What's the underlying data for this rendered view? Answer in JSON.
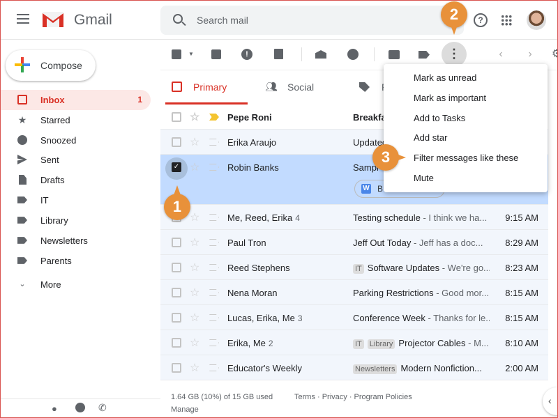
{
  "header": {
    "brand": "Gmail",
    "search_placeholder": "Search mail",
    "help": "?"
  },
  "compose": "Compose",
  "sidebar": {
    "items": [
      {
        "label": "Inbox",
        "count": "1",
        "icon": "inbox-icon"
      },
      {
        "label": "Starred",
        "icon": "star-icon"
      },
      {
        "label": "Snoozed",
        "icon": "clock-icon"
      },
      {
        "label": "Sent",
        "icon": "send-icon"
      },
      {
        "label": "Drafts",
        "icon": "draft-icon"
      },
      {
        "label": "IT",
        "icon": "label-icon"
      },
      {
        "label": "Library",
        "icon": "label-icon"
      },
      {
        "label": "Newsletters",
        "icon": "label-icon"
      },
      {
        "label": "Parents",
        "icon": "label-icon"
      },
      {
        "label": "More",
        "icon": "chevron-down-icon"
      }
    ]
  },
  "tabs": [
    {
      "label": "Primary"
    },
    {
      "label": "Social"
    },
    {
      "label": "P"
    }
  ],
  "emails": [
    {
      "from": "Pepe Roni",
      "subject": "Breakfa",
      "snippet": "",
      "time": "",
      "unread": true
    },
    {
      "from": "Erika Araujo",
      "subject": "Updated",
      "snippet": "",
      "time": ""
    },
    {
      "from": "Robin Banks",
      "subject": "Sampl",
      "snippet": "",
      "time": "",
      "selected": true,
      "attachment": "B"
    },
    {
      "from": "Me, Reed, Erika",
      "count": "4",
      "subject": "Testing schedule",
      "snippet": " - I think we ha...",
      "time": "9:15 AM"
    },
    {
      "from": "Paul Tron",
      "subject": "Jeff Out Today ",
      "snippet": " - Jeff has a doc...",
      "time": "8:29 AM"
    },
    {
      "from": "Reed Stephens",
      "tags": [
        "IT"
      ],
      "subject": "Software Updates",
      "snippet": " - We're go...",
      "time": "8:23 AM"
    },
    {
      "from": "Nena Moran",
      "subject": "Parking Restrictions",
      "snippet": " - Good mor...",
      "time": "8:15 AM"
    },
    {
      "from": "Lucas, Erika, Me",
      "count": "3",
      "subject": "Conference Week",
      "snippet": " - Thanks for le...",
      "time": "8:15 AM"
    },
    {
      "from": "Erika, Me",
      "count": "2",
      "tags": [
        "IT",
        "Library"
      ],
      "subject": "Projector Cables",
      "snippet": " - M...",
      "time": "8:10 AM"
    },
    {
      "from": "Educator's Weekly",
      "tags": [
        "Newsletters"
      ],
      "subject": "Modern Nonfiction...",
      "snippet": "",
      "time": "2:00 AM"
    }
  ],
  "menu": [
    "Mark as unread",
    "Mark as important",
    "Add to Tasks",
    "Add star",
    "Filter messages like these",
    "Mute"
  ],
  "callouts": [
    "1",
    "2",
    "3"
  ],
  "footer": {
    "storage": "1.64 GB (10%) of 15 GB used",
    "manage": "Manage",
    "links": "Terms · Privacy · Program Policies"
  },
  "colors": {
    "accent": "#d93025",
    "selected_row": "#c2dbff",
    "callout": "#e8913a"
  }
}
